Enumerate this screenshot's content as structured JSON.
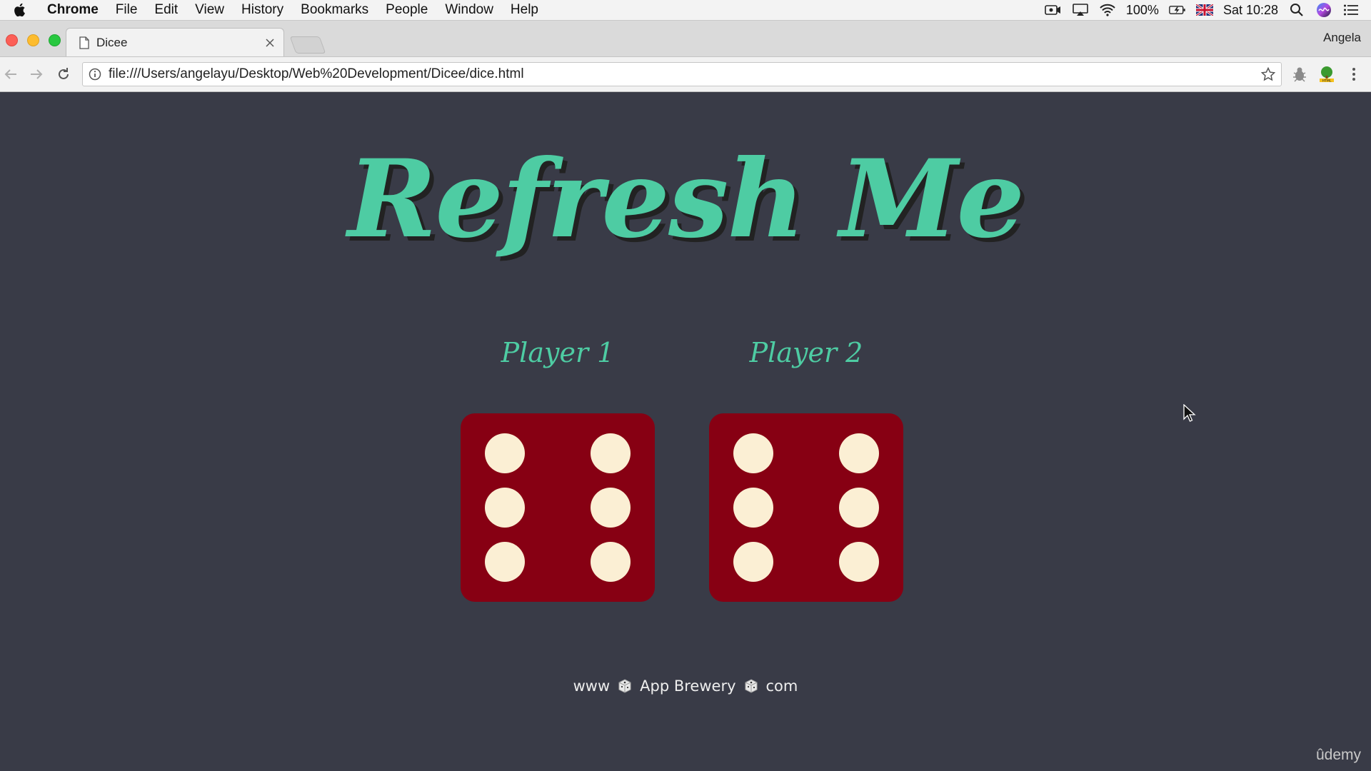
{
  "menubar": {
    "app_name": "Chrome",
    "items": [
      "File",
      "Edit",
      "View",
      "History",
      "Bookmarks",
      "People",
      "Window",
      "Help"
    ],
    "battery": "100%",
    "clock": "Sat 10:28"
  },
  "browser": {
    "tab_title": "Dicee",
    "profile_name": "Angela",
    "url": "file:///Users/angelayu/Desktop/Web%20Development/Dicee/dice.html"
  },
  "page": {
    "title": "Refresh Me",
    "players": [
      {
        "label": "Player 1",
        "die_value": 6
      },
      {
        "label": "Player 2",
        "die_value": 6
      }
    ],
    "footer": {
      "part1": "www",
      "part2": "App Brewery",
      "part3": "com"
    },
    "watermark": "ûdemy"
  },
  "colors": {
    "background": "#393b47",
    "accent": "#4ecca3",
    "die_face": "#870013",
    "pip": "#fbefd4"
  }
}
